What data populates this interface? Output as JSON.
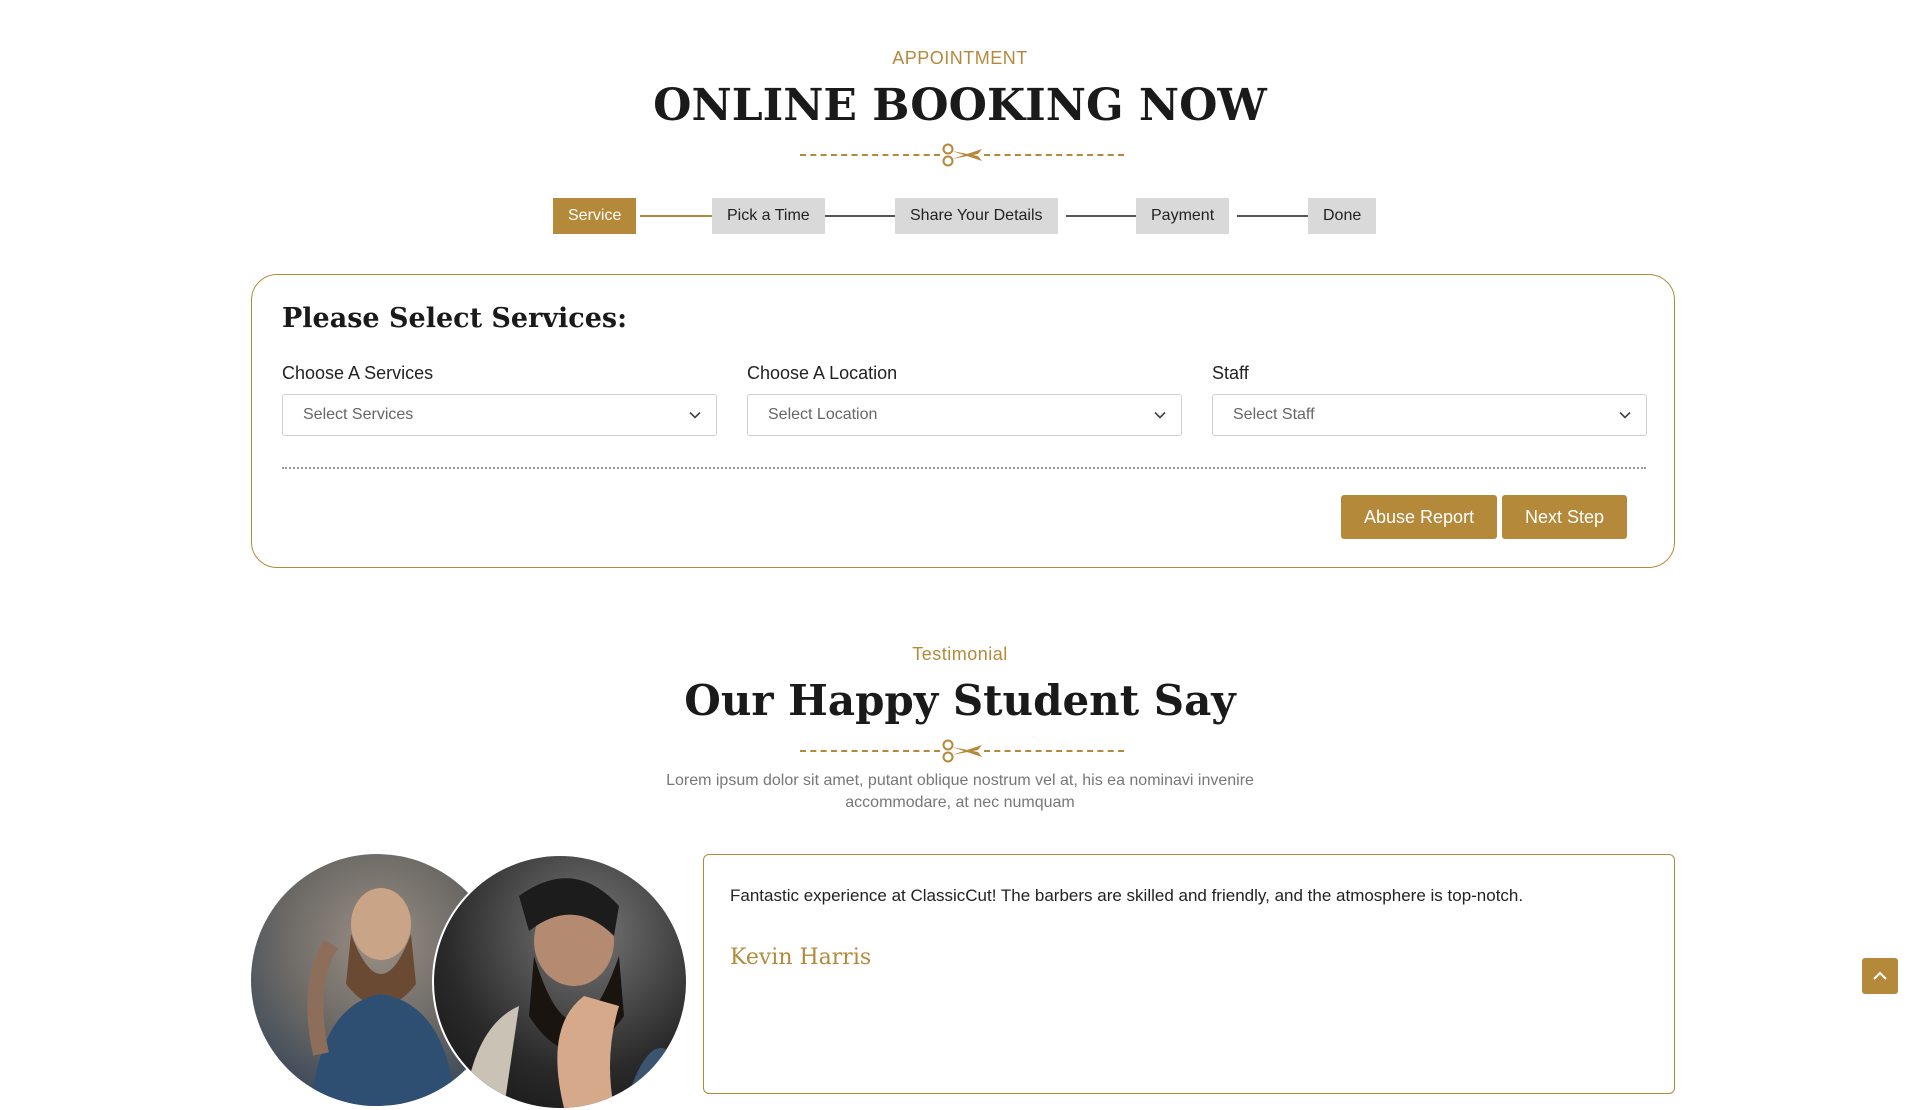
{
  "booking": {
    "eyebrow": "APPOINTMENT",
    "title": "ONLINE BOOKING NOW",
    "steps": [
      {
        "label": "Service",
        "active": true
      },
      {
        "label": "Pick a Time",
        "active": false
      },
      {
        "label": "Share Your Details",
        "active": false
      },
      {
        "label": "Payment",
        "active": false
      },
      {
        "label": "Done",
        "active": false
      }
    ],
    "form_title": "Please Select Services:",
    "fields": [
      {
        "label": "Choose A Services",
        "placeholder": "Select Services"
      },
      {
        "label": "Choose A Location",
        "placeholder": "Select Location"
      },
      {
        "label": "Staff",
        "placeholder": "Select Staff"
      }
    ],
    "buttons": {
      "abuse": "Abuse Report",
      "next": "Next Step"
    }
  },
  "testimonial": {
    "eyebrow": "Testimonial",
    "title": "Our Happy Student Say",
    "lead_line1": "Lorem ipsum dolor sit amet, putant oblique nostrum vel at, his ea nominavi invenire",
    "lead_line2": "accommodare, at nec numquam",
    "quote": "Fantastic experience at ClassicCut! The barbers are skilled and friendly, and the atmosphere is top-notch.",
    "author": "Kevin Harris"
  },
  "icons": {
    "divider": "scissors-icon",
    "select": "chevron-down-icon",
    "back_to_top": "chevron-up-icon"
  },
  "colors": {
    "accent": "#b5893a",
    "step_inactive": "#d9d9d9"
  }
}
